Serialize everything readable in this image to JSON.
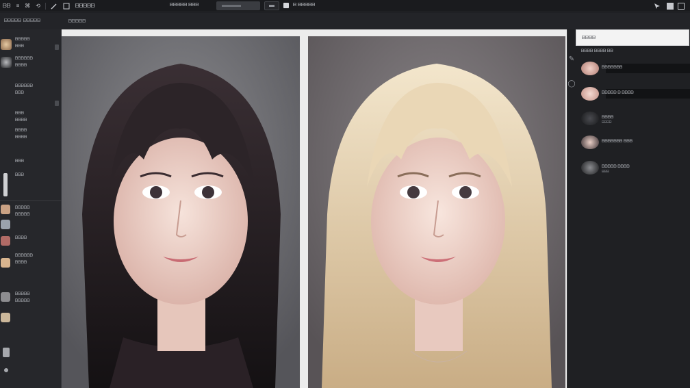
{
  "toolbar": {
    "file_label": "ᗷᗷ",
    "tool2_label": "≡",
    "tool3_label": "⌘",
    "tool4_label": "⟲",
    "title": "ᗷᗷᗷᗷᗷ",
    "doc_name": "ᗷᗷᗷᗷᗷ ᗷᗷᗷ",
    "view_label": "ᗷ ᗷᗷᗷᗷᗷ"
  },
  "subbar": {
    "tab1": "ᗷᗷᗷᗷᗷ",
    "tab2": "ᗷᗷᗷᗷᗷ"
  },
  "left_panel": {
    "rows": [
      {
        "label": "ᗷᗷᗷᗷᗷ",
        "sub": "ᗷᗷᗷ"
      },
      {
        "label": "ᗷᗷᗷᗷᗷᗷ",
        "sub": "ᗷᗷᗷᗷ"
      },
      {
        "label": "ᗷᗷᗷᗷᗷᗷ",
        "sub": "ᗷᗷᗷ"
      },
      {
        "label": "ᗷᗷᗷ",
        "sub": "ᗷᗷᗷᗷ"
      },
      {
        "label": "ᗷᗷᗷᗷ",
        "sub": "ᗷᗷᗷᗷ"
      },
      {
        "label": "ᗷᗷᗷ",
        "sub": "ᗷᗷᗷ"
      },
      {
        "label": "ᗷᗷᗷᗷᗷ",
        "sub": "ᗷᗷᗷᗷᗷ"
      },
      {
        "label": "ᗷᗷᗷᗷ",
        "sub": "ᗷᗷᗷ"
      },
      {
        "label": "ᗷᗷᗷᗷᗷᗷ",
        "sub": "ᗷᗷᗷᗷ"
      },
      {
        "label": "ᗷᗷᗷᗷᗷ",
        "sub": "ᗷᗷᗷᗷᗷ"
      }
    ]
  },
  "right_panel": {
    "header": "ᗷᗷᗷᗷ",
    "section": "ᗷᗷᗷᗷ ᗷᗷᗷᗷ ᗷᗷ",
    "items": [
      {
        "label": "ᗷᗷᗷᗷᗷᗷᗷ",
        "sub": ""
      },
      {
        "label": "ᗷᗷᗷᗷᗷ ᗷ ᗷᗷᗷᗷ",
        "sub": ""
      },
      {
        "label": "ᗷᗷᗷᗷ",
        "sub": "ᗷᗷᗷᗷ"
      },
      {
        "label": "ᗷᗷᗷᗷᗷᗷᗷ ᗷᗷᗷ",
        "sub": ""
      },
      {
        "label": "ᗷᗷᗷᗷᗷ ᗷᗷᗷᗷ",
        "sub": "ᗷᗷᗷ"
      }
    ]
  },
  "colors": {
    "hair_dark": "#2a2327",
    "hair_blonde": "#e4d1b0",
    "skin": "#f1d9d0",
    "bg_dark_panel": "#707074",
    "bg_light_panel": "#6b6669"
  }
}
